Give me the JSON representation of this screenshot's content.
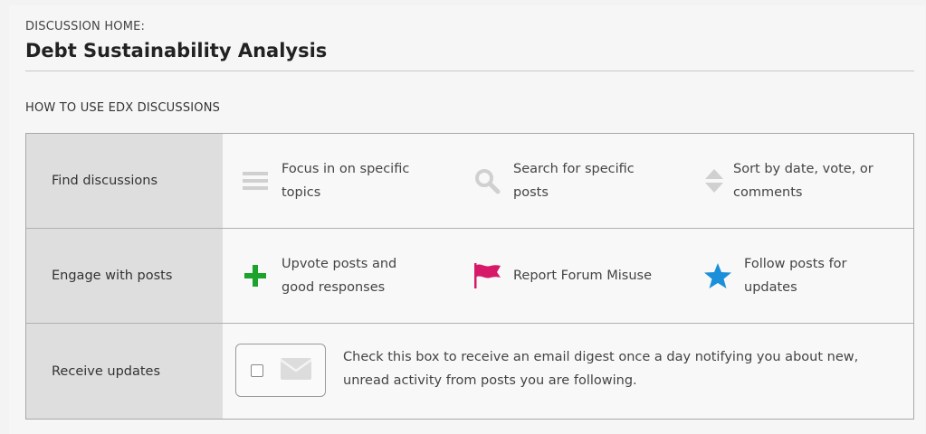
{
  "header": {
    "label": "DISCUSSION HOME:",
    "title": "Debt Sustainability Analysis"
  },
  "guide": {
    "section_label": "HOW TO USE EDX DISCUSSIONS",
    "rows": [
      {
        "heading": "Find discussions",
        "items": [
          {
            "icon": "list-icon",
            "text": "Focus in on specific topics"
          },
          {
            "icon": "search-icon",
            "text": "Search for specific posts"
          },
          {
            "icon": "sort-icon",
            "text": "Sort by date, vote, or comments"
          }
        ]
      },
      {
        "heading": "Engage with posts",
        "items": [
          {
            "icon": "plus-icon",
            "text": "Upvote posts and good responses"
          },
          {
            "icon": "flag-icon",
            "text": "Report Forum Misuse"
          },
          {
            "icon": "star-icon",
            "text": "Follow posts for updates"
          }
        ]
      },
      {
        "heading": "Receive updates",
        "digest": {
          "checked": false,
          "icon": "mail-icon",
          "text": "Check this box to receive an email digest once a day notifying you about new, unread activity from posts you are following."
        }
      }
    ]
  },
  "colors": {
    "plus": "#1ba32c",
    "flag": "#d7196a",
    "star": "#1b8fd9",
    "muted_icon": "#cfcfcf"
  }
}
